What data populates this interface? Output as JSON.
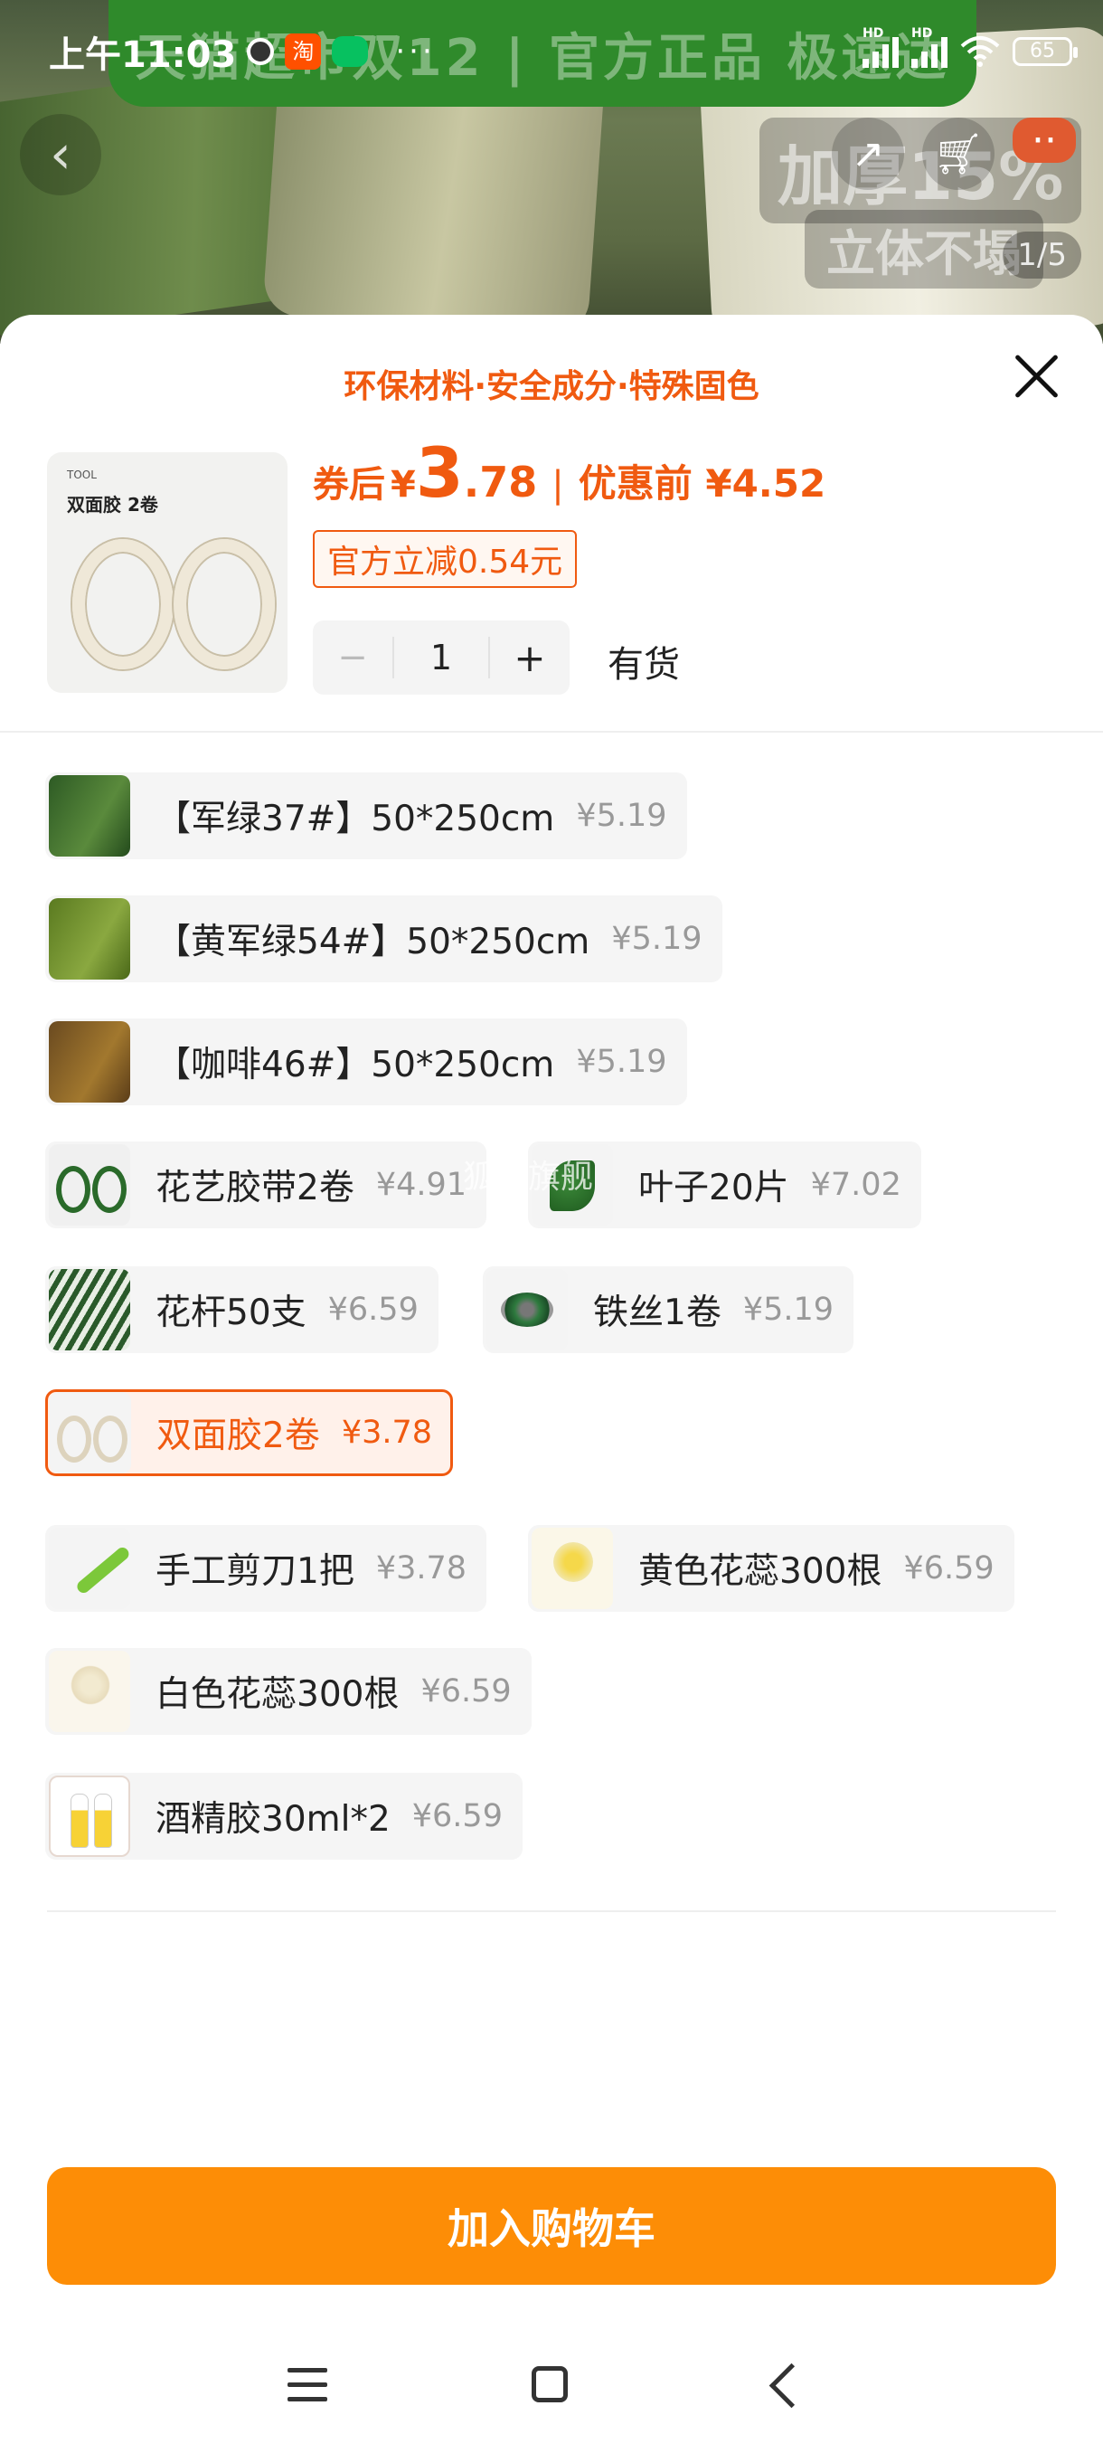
{
  "status_bar": {
    "time": "上午11:03",
    "taobao_badge": "淘",
    "more": "···",
    "signal_hd": "HD",
    "battery": "65"
  },
  "hero": {
    "banner_text": "天猫超市双12 | 官方正品 极速达",
    "overlay_text_1": "加厚15%",
    "overlay_text_2": "立体不塌",
    "page_indicator": "1/5",
    "icons": [
      "back-icon",
      "share-icon",
      "cart-icon",
      "more-icon"
    ]
  },
  "sheet": {
    "title": "环保材料·安全成分·特殊固色",
    "product_thumb": {
      "brand": "TOOL",
      "name": "双面胶 2卷"
    },
    "price": {
      "label": "券后",
      "currency": "¥",
      "integer": "3",
      "decimal": ".78",
      "separator": "|",
      "original_label": "优惠前 ¥4.52"
    },
    "discount_tag": "官方立减0.54元",
    "quantity": {
      "minus": "−",
      "value": "1",
      "plus": "+"
    },
    "stock_status": "有货",
    "accent_color": "#f05a10"
  },
  "options": [
    {
      "name": "【军绿37#】50*250cm",
      "price": "¥5.19"
    },
    {
      "name": "【黄军绿54#】50*250cm",
      "price": "¥5.19"
    },
    {
      "name": "【咖啡46#】50*250cm",
      "price": "¥5.19"
    },
    {
      "name": "花艺胶带2卷",
      "price": "¥4.91"
    },
    {
      "name": "叶子20片",
      "price": "¥7.02"
    },
    {
      "name": "花杆50支",
      "price": "¥6.59"
    },
    {
      "name": "铁丝1卷",
      "price": "¥5.19"
    },
    {
      "name": "双面胶2卷",
      "price": "¥3.78",
      "selected": true
    },
    {
      "name": "手工剪刀1把",
      "price": "¥3.78"
    },
    {
      "name": "黄色花蕊300根",
      "price": "¥6.59"
    },
    {
      "name": "白色花蕊300根",
      "price": "¥6.59"
    },
    {
      "name": "酒精胶30ml*2",
      "price": "¥6.59"
    }
  ],
  "watermark": "狐月旗舰",
  "footer": {
    "add_to_cart": "加入购物车",
    "button_color": "#fd8d06"
  }
}
